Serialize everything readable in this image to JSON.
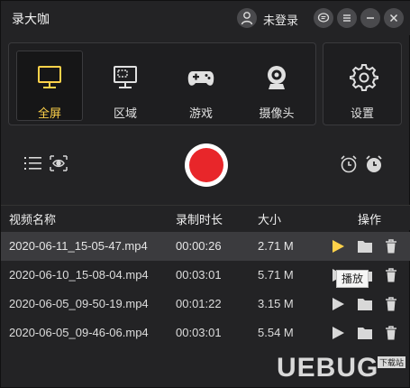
{
  "app": {
    "title": "录大咖",
    "login_label": "未登录"
  },
  "modes": [
    {
      "label": "全屏",
      "icon": "monitor-icon",
      "active": true
    },
    {
      "label": "区域",
      "icon": "region-icon",
      "active": false
    },
    {
      "label": "游戏",
      "icon": "gamepad-icon",
      "active": false
    },
    {
      "label": "摄像头",
      "icon": "webcam-icon",
      "active": false
    }
  ],
  "settings": {
    "label": "设置",
    "icon": "gear-icon"
  },
  "table": {
    "headers": {
      "name": "视频名称",
      "duration": "录制时长",
      "size": "大小",
      "actions": "操作"
    },
    "rows": [
      {
        "name": "2020-06-11_15-05-47.mp4",
        "duration": "00:00:26",
        "size": "2.71 M",
        "selected": true
      },
      {
        "name": "2020-06-10_15-08-04.mp4",
        "duration": "00:03:01",
        "size": "5.71 M",
        "selected": false
      },
      {
        "name": "2020-06-05_09-50-19.mp4",
        "duration": "00:01:22",
        "size": "3.15 M",
        "selected": false
      },
      {
        "name": "2020-06-05_09-46-06.mp4",
        "duration": "00:03:01",
        "size": "5.54 M",
        "selected": false
      }
    ]
  },
  "tooltip": "播放",
  "watermark": {
    "text": "UEBUG",
    "sub": "下载站"
  },
  "colors": {
    "accent": "#ffd24a",
    "record": "#e8262a",
    "background": "#232325"
  }
}
